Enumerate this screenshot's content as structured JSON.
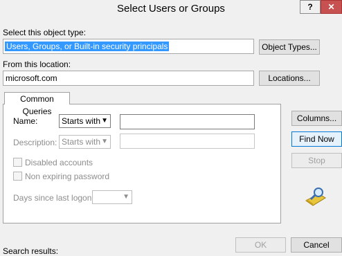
{
  "window": {
    "title": "Select Users or Groups",
    "help_label": "?",
    "close_label": "✕"
  },
  "object_type": {
    "label": "Select this object type:",
    "value": "Users, Groups, or Built-in security principals",
    "button": "Object Types..."
  },
  "location": {
    "label": "From this location:",
    "value": "microsoft.com",
    "button": "Locations..."
  },
  "tabs": [
    {
      "label": "Common Queries"
    }
  ],
  "query": {
    "name_label": "Name:",
    "name_mode": "Starts with",
    "name_value": "",
    "description_label": "Description:",
    "description_mode": "Starts with",
    "description_value": "",
    "disabled_accounts_label": "Disabled accounts",
    "non_expiring_label": "Non expiring password",
    "days_since_label": "Days since last logon:",
    "days_value": ""
  },
  "side_buttons": {
    "columns": "Columns...",
    "find_now": "Find Now",
    "stop": "Stop"
  },
  "footer": {
    "search_results_label": "Search results:",
    "ok": "OK",
    "cancel": "Cancel"
  },
  "icons": {
    "search": "magnifier-icon"
  }
}
